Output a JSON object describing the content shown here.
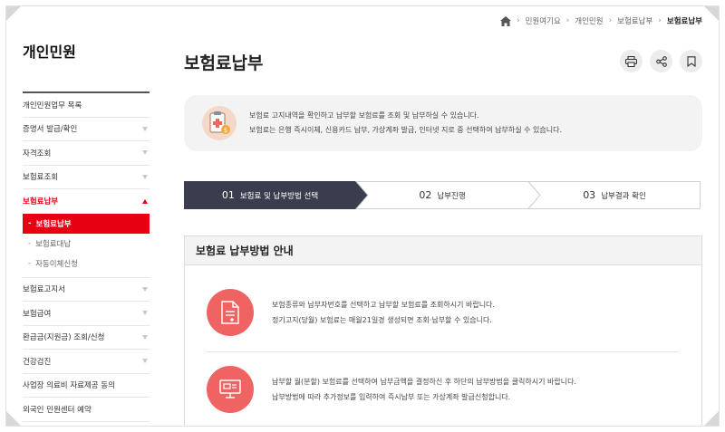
{
  "breadcrumb": {
    "items": [
      "민원여기요",
      "개인민원",
      "보험료납부",
      "보험료납부"
    ]
  },
  "sidebar": {
    "title": "개인민원",
    "items": [
      {
        "label": "개인민원업무 목록"
      },
      {
        "label": "증명서 발급/확인"
      },
      {
        "label": "자격조회"
      },
      {
        "label": "보험료조회"
      },
      {
        "label": "보험료납부"
      },
      {
        "label": "보험료고지서"
      },
      {
        "label": "보험급여"
      },
      {
        "label": "환급금(지원금) 조회/신청"
      },
      {
        "label": "건강검진"
      },
      {
        "label": "사업장 의료비 자료제공 동의"
      },
      {
        "label": "외국인 민원센터 예약"
      }
    ],
    "subitems": [
      {
        "label": "보험료납부"
      },
      {
        "label": "보험료대납"
      },
      {
        "label": "자동이체신청"
      }
    ]
  },
  "main": {
    "title": "보험료납부",
    "info_line1": "보험료 고지내역을 확인하고 납부할 보험료를 조회 및 납부하실 수 있습니다.",
    "info_line2": "보험료는 은행 즉시이체, 신용카드 납부, 가상계좌 발급, 인터넷 지로 중 선택하여 납부하실 수 있습니다."
  },
  "steps": [
    {
      "num": "01",
      "label": "보험료 및 납부방법 선택"
    },
    {
      "num": "02",
      "label": "납부진행"
    },
    {
      "num": "03",
      "label": "납부결과 확인"
    }
  ],
  "guide": {
    "title": "보험료 납부방법 안내",
    "row1_line1": "보험종류와 납부자번호를 선택하고 납부할 보험료를 조회하시기 바랍니다.",
    "row1_line2": "정기고지(당월) 보험료는 매월21일경 생성되면 조회·납부할 수 있습니다.",
    "row2_line1": "납부할 월(분할) 보험료를 선택하여 납부금액을 결정하신 후 하단의 납부방법을 클릭하시기 바랍니다.",
    "row2_line2": "납부방법에 따라 추가정보를 입력하여 즉시납부 또는 가상계좌 발급신청합니다."
  },
  "colors": {
    "accent": "#e60012",
    "step_active": "#3a3d4d",
    "guide_icon": "#ef6362"
  },
  "icons": [
    "home-icon",
    "chevron-right-icon",
    "print-icon",
    "share-icon",
    "bookmark-icon",
    "caret-down-icon",
    "caret-up-icon",
    "document-icon",
    "monitor-icon"
  ]
}
